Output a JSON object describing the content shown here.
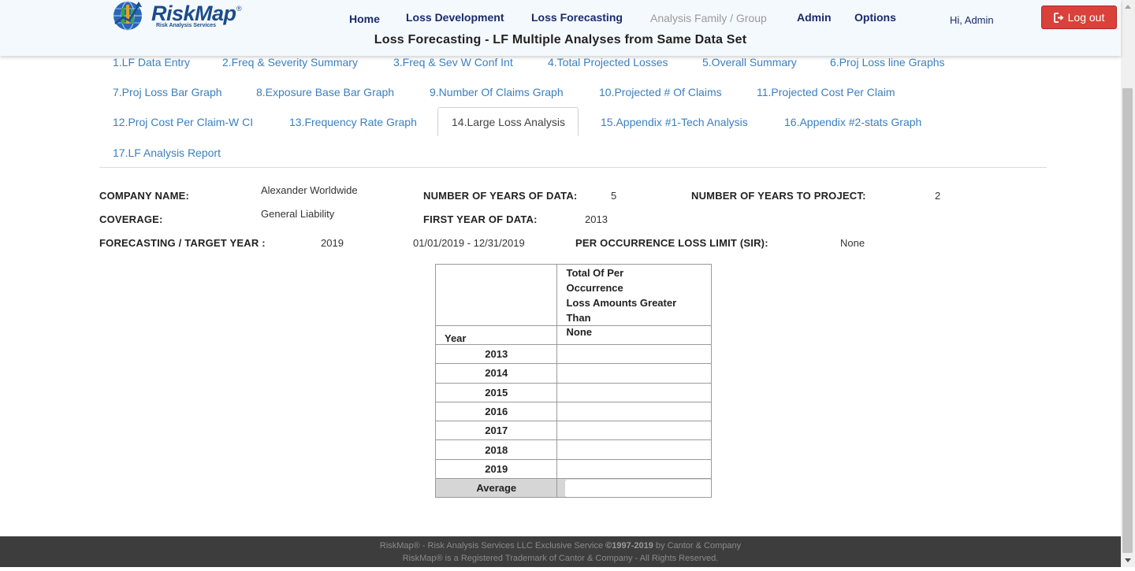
{
  "header": {
    "logo_text": "RiskMap",
    "logo_reg": "®",
    "logo_sub": "Risk Analysis Services",
    "nav": [
      {
        "label": "Home",
        "enabled": true
      },
      {
        "label": "Loss Development",
        "enabled": true
      },
      {
        "label": "Loss Forecasting",
        "enabled": true
      },
      {
        "label": "Analysis Family / Group",
        "enabled": false
      },
      {
        "label": "Admin",
        "enabled": true
      },
      {
        "label": "Options",
        "enabled": true
      }
    ],
    "greeting": "Hi, Admin",
    "logout_label": "Log out",
    "page_title": "Loss Forecasting - LF Multiple Analyses from Same Data Set"
  },
  "tabs": [
    "1.LF Data Entry",
    "2.Freq & Severity Summary",
    "3.Freq & Sev W Conf Int",
    "4.Total Projected Losses",
    "5.Overall Summary",
    "6.Proj Loss line Graphs",
    "7.Proj Loss Bar Graph",
    "8.Exposure Base Bar Graph",
    "9.Number Of Claims Graph",
    "10.Projected # Of Claims",
    "11.Projected Cost Per Claim",
    "12.Proj Cost Per Claim-W CI",
    "13.Frequency Rate Graph",
    "14.Large Loss Analysis",
    "15.Appendix #1-Tech Analysis",
    "16.Appendix #2-stats Graph",
    "17.LF Analysis Report"
  ],
  "active_tab": "14.Large Loss Analysis",
  "info": {
    "company_label": "COMPANY NAME:",
    "company_value": "Alexander Worldwide",
    "years_data_label": "NUMBER OF YEARS OF DATA:",
    "years_data_value": "5",
    "years_project_label": "NUMBER OF YEARS TO PROJECT:",
    "years_project_value": "2",
    "coverage_label": "COVERAGE:",
    "coverage_value": "General Liability",
    "first_year_label": "FIRST YEAR OF DATA:",
    "first_year_value": "2013",
    "target_year_label": "FORECASTING / TARGET YEAR :",
    "target_year_value": "2019",
    "target_range": "01/01/2019 - 12/31/2019",
    "sir_label": "PER OCCURRENCE LOSS LIMIT (SIR):",
    "sir_value": "None"
  },
  "table": {
    "header_line1": "Total Of Per",
    "header_line2": "Occurrence",
    "header_line3": "Loss Amounts Greater",
    "header_line4": "Than",
    "year_label": "Year",
    "threshold_label": "None",
    "rows": [
      {
        "year": "2013",
        "value": ""
      },
      {
        "year": "2014",
        "value": ""
      },
      {
        "year": "2015",
        "value": ""
      },
      {
        "year": "2016",
        "value": ""
      },
      {
        "year": "2017",
        "value": ""
      },
      {
        "year": "2018",
        "value": ""
      },
      {
        "year": "2019",
        "value": ""
      }
    ],
    "average_label": "Average",
    "average_value": ""
  },
  "footer": {
    "line1_a": "RiskMap® - Risk Analysis Services LLC Exclusive Service ",
    "line1_b": "©1997-2019",
    "line1_c": " by Cantor & Company",
    "line2": "RiskMap® is a Registered Trademark of Cantor & Company - All Rights Reserved."
  },
  "colors": {
    "nav_text": "#1a2a6c",
    "tab_link": "#3b7fc0",
    "logout_bg": "#d9413a",
    "footer_bg": "#3d3d3d"
  }
}
